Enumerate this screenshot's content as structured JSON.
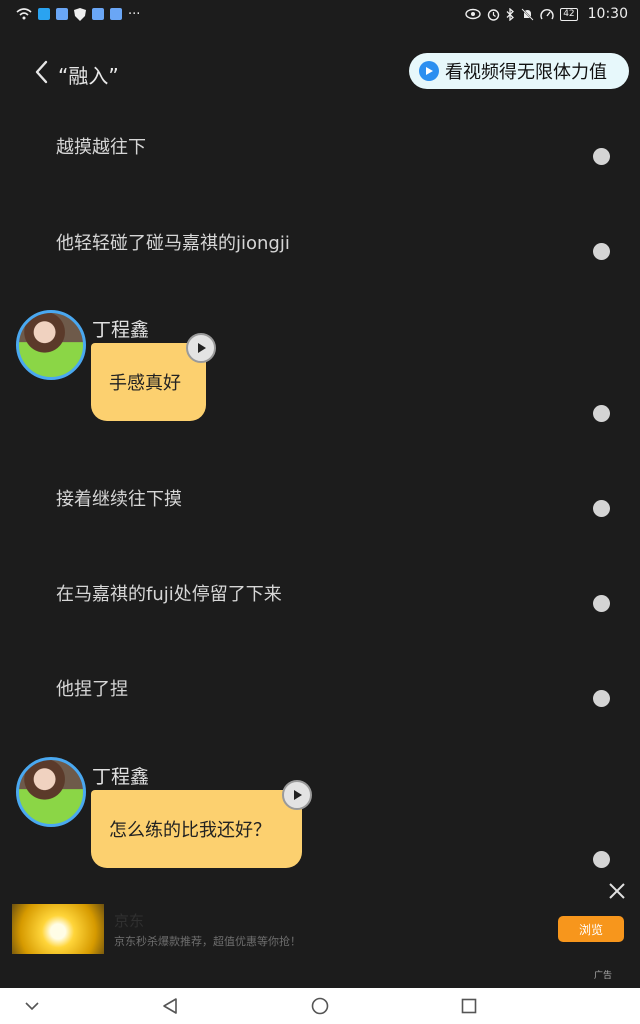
{
  "status_bar": {
    "time": "10:30",
    "battery": "42",
    "icons": [
      "wifi-icon",
      "message-icon",
      "app-icon",
      "shield-icon",
      "app-icon",
      "app-icon",
      "more-icon",
      "eye-icon",
      "alarm-icon",
      "bluetooth-icon",
      "mute-icon",
      "speed-icon",
      "battery-icon"
    ]
  },
  "header": {
    "back_icon": "chevron-left-icon",
    "title": "“融入”",
    "video_button": "看视频得无限体力值"
  },
  "story": {
    "lines": [
      "越摸越往下",
      "他轻轻碰了碰马嘉祺的jiongji",
      "接着继续往下摸",
      "在马嘉祺的fuji处停留了下来",
      "他捏了捏"
    ],
    "dialogs": [
      {
        "speaker": "丁程鑫",
        "text": "手感真好"
      },
      {
        "speaker": "丁程鑫",
        "text": "怎么练的比我还好？"
      }
    ]
  },
  "ad": {
    "title": "京东",
    "description": "京东秒杀爆款推荐，超值优惠等你抢！",
    "button": "浏览",
    "tag": "广告"
  },
  "nav": {
    "icons": [
      "chevron-down-icon",
      "back-triangle-icon",
      "home-circle-icon",
      "recent-square-icon"
    ]
  },
  "colors": {
    "background": "#1c1c1c",
    "bubble": "#fcd06f",
    "avatar_ring": "#4aa8f0",
    "ad_button": "#f7961c",
    "pill_bg": "#e7f8fb"
  }
}
